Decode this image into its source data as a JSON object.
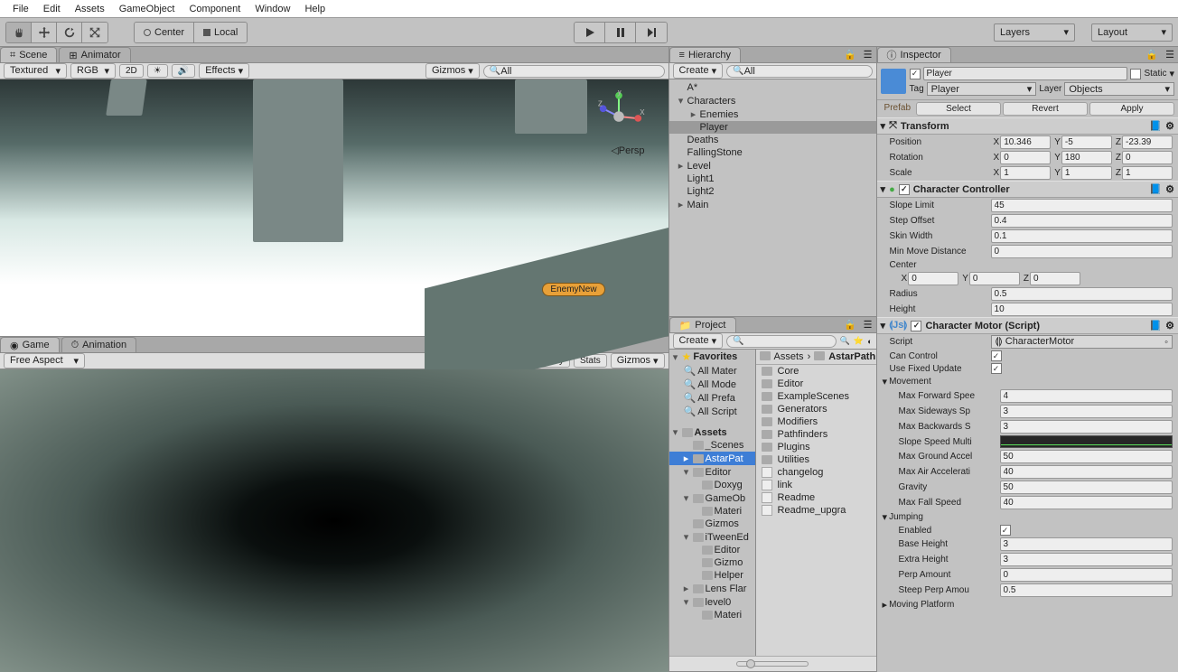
{
  "menubar": [
    "File",
    "Edit",
    "Assets",
    "GameObject",
    "Component",
    "Window",
    "Help"
  ],
  "toolbar": {
    "center": "Center",
    "local": "Local",
    "layers": "Layers",
    "layout": "Layout"
  },
  "scene": {
    "tab_scene": "Scene",
    "tab_animator": "Animator",
    "shading": "Textured",
    "rendermode": "RGB",
    "effects": "Effects",
    "gizmos": "Gizmos",
    "search": "All",
    "persp": "Persp",
    "enemy_tag": "EnemyNew"
  },
  "game": {
    "tab_game": "Game",
    "tab_anim": "Animation",
    "aspect": "Free Aspect",
    "maxplay": "Maximize on Play",
    "stats": "Stats",
    "gizmos": "Gizmos"
  },
  "hierarchy": {
    "title": "Hierarchy",
    "create": "Create",
    "search": "All",
    "items": [
      {
        "name": "A*",
        "indent": 0,
        "expand": ""
      },
      {
        "name": "Characters",
        "indent": 0,
        "expand": "▾"
      },
      {
        "name": "Enemies",
        "indent": 1,
        "expand": "▸"
      },
      {
        "name": "Player",
        "indent": 1,
        "expand": "",
        "sel": true
      },
      {
        "name": "Deaths",
        "indent": 0,
        "expand": ""
      },
      {
        "name": "FallingStone",
        "indent": 0,
        "expand": ""
      },
      {
        "name": "Level",
        "indent": 0,
        "expand": "▸"
      },
      {
        "name": "Light1",
        "indent": 0,
        "expand": ""
      },
      {
        "name": "Light2",
        "indent": 0,
        "expand": ""
      },
      {
        "name": "Main",
        "indent": 0,
        "expand": "▸"
      }
    ]
  },
  "project": {
    "title": "Project",
    "create": "Create",
    "favorites": "Favorites",
    "searches": [
      "All Mater",
      "All Mode",
      "All Prefa",
      "All Script"
    ],
    "assets_root": "Assets",
    "tree": [
      {
        "n": "_Scenes",
        "i": 1,
        "e": ""
      },
      {
        "n": "AstarPat",
        "i": 1,
        "e": "▸",
        "sel": true
      },
      {
        "n": "Editor",
        "i": 1,
        "e": "▾"
      },
      {
        "n": "Doxyg",
        "i": 2,
        "e": ""
      },
      {
        "n": "GameOb",
        "i": 1,
        "e": "▾"
      },
      {
        "n": "Materi",
        "i": 2,
        "e": ""
      },
      {
        "n": "Gizmos",
        "i": 1,
        "e": ""
      },
      {
        "n": "iTweenEd",
        "i": 1,
        "e": "▾"
      },
      {
        "n": "Editor",
        "i": 2,
        "e": ""
      },
      {
        "n": "Gizmo",
        "i": 2,
        "e": ""
      },
      {
        "n": "Helper",
        "i": 2,
        "e": ""
      },
      {
        "n": "Lens Flar",
        "i": 1,
        "e": "▸"
      },
      {
        "n": "level0",
        "i": 1,
        "e": "▾"
      },
      {
        "n": "Materi",
        "i": 2,
        "e": ""
      }
    ],
    "breadcrumb": [
      "Assets",
      "AstarPath"
    ],
    "contents": [
      {
        "n": "Core",
        "t": "folder"
      },
      {
        "n": "Editor",
        "t": "folder"
      },
      {
        "n": "ExampleScenes",
        "t": "folder"
      },
      {
        "n": "Generators",
        "t": "folder"
      },
      {
        "n": "Modifiers",
        "t": "folder"
      },
      {
        "n": "Pathfinders",
        "t": "folder"
      },
      {
        "n": "Plugins",
        "t": "folder"
      },
      {
        "n": "Utilities",
        "t": "folder"
      },
      {
        "n": "changelog",
        "t": "file"
      },
      {
        "n": "link",
        "t": "file"
      },
      {
        "n": "Readme",
        "t": "file"
      },
      {
        "n": "Readme_upgra",
        "t": "file"
      }
    ]
  },
  "inspector": {
    "title": "Inspector",
    "name": "Player",
    "static": "Static",
    "tag_lbl": "Tag",
    "tag": "Player",
    "layer_lbl": "Layer",
    "layer": "Objects",
    "prefab_lbl": "Prefab",
    "select": "Select",
    "revert": "Revert",
    "apply": "Apply",
    "transform": {
      "title": "Transform",
      "position": "Position",
      "pos": {
        "x": "10.346",
        "y": "-5",
        "z": "-23.39"
      },
      "rotation": "Rotation",
      "rot": {
        "x": "0",
        "y": "180",
        "z": "0"
      },
      "scale": "Scale",
      "scl": {
        "x": "1",
        "y": "1",
        "z": "1"
      }
    },
    "charcontroller": {
      "title": "Character Controller",
      "slope": "Slope Limit",
      "slope_v": "45",
      "step": "Step Offset",
      "step_v": "0.4",
      "skin": "Skin Width",
      "skin_v": "0.1",
      "minmove": "Min Move Distance",
      "minmove_v": "0",
      "center": "Center",
      "cx": "0",
      "cy": "0",
      "cz": "0",
      "radius": "Radius",
      "radius_v": "0.5",
      "height": "Height",
      "height_v": "10"
    },
    "charmotor": {
      "title": "Character Motor (Script)",
      "script_lbl": "Script",
      "script": "CharacterMotor",
      "cancontrol": "Can Control",
      "usefixed": "Use Fixed Update",
      "movement": "Movement",
      "maxfw": "Max Forward Spee",
      "maxfw_v": "4",
      "maxside": "Max Sideways Sp",
      "maxside_v": "3",
      "maxback": "Max Backwards S",
      "maxback_v": "3",
      "slopespeed": "Slope Speed Multi",
      "maxground": "Max Ground Accel",
      "maxground_v": "50",
      "maxair": "Max Air Accelerati",
      "maxair_v": "40",
      "gravity": "Gravity",
      "gravity_v": "50",
      "maxfall": "Max Fall Speed",
      "maxfall_v": "40",
      "jumping": "Jumping",
      "enabled": "Enabled",
      "baseheight": "Base Height",
      "baseheight_v": "3",
      "extraheight": "Extra Height",
      "extraheight_v": "3",
      "perp": "Perp Amount",
      "perp_v": "0",
      "steep": "Steep Perp Amou",
      "steep_v": "0.5",
      "movingplatform": "Moving Platform"
    }
  }
}
